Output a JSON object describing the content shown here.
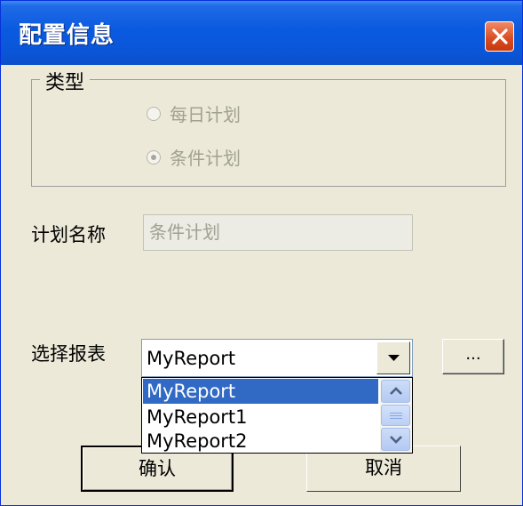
{
  "window": {
    "title": "配置信息"
  },
  "type_group": {
    "legend": "类型",
    "options": [
      {
        "label": "每日计划",
        "checked": false
      },
      {
        "label": "条件计划",
        "checked": true
      }
    ]
  },
  "plan_name": {
    "label": "计划名称",
    "value": "条件计划"
  },
  "report": {
    "label": "选择报表",
    "selected": "MyReport",
    "browse_label": "...",
    "options": [
      "MyReport",
      "MyReport1",
      "MyReport2"
    ]
  },
  "buttons": {
    "ok": "确认",
    "cancel": "取消"
  },
  "colors": {
    "title_bar": "#0a56d8",
    "selection": "#316ac5",
    "dialog_bg": "#ece9d8",
    "close_button": "#d94a1f"
  }
}
